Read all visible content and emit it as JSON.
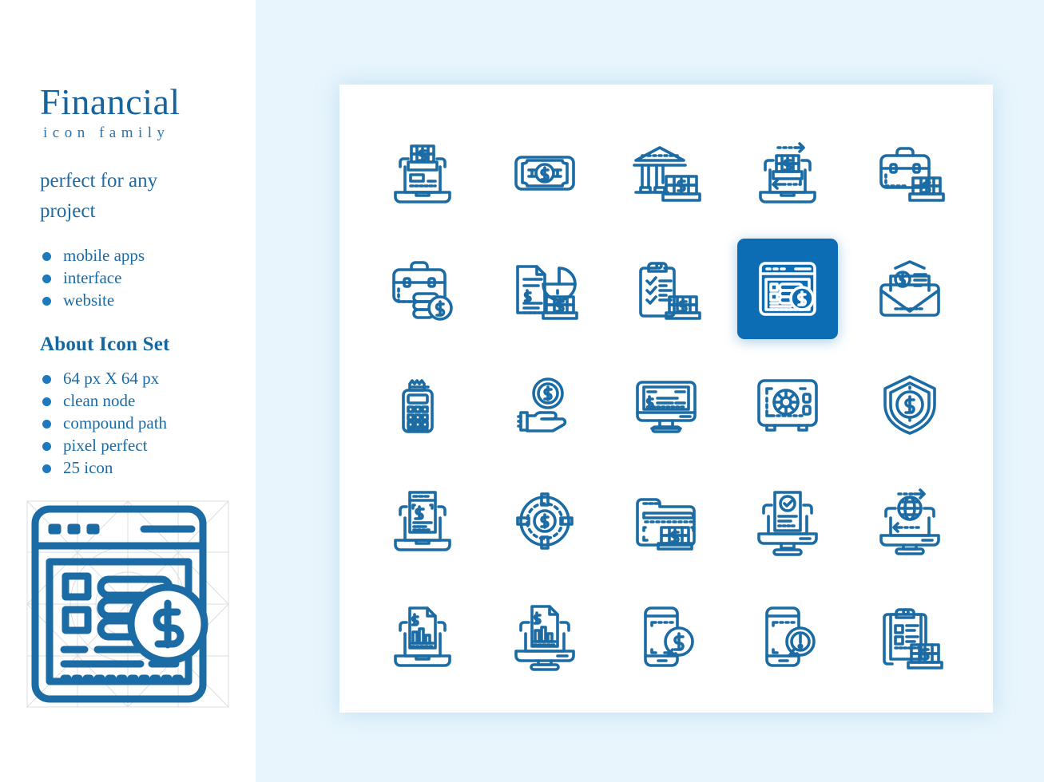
{
  "panel": {
    "title": "Financial",
    "subtitle": "icon family",
    "tagline": "perfect for any project",
    "usage_bullets": [
      "mobile apps",
      "interface",
      "website"
    ],
    "section_head": "About Icon Set",
    "spec_bullets": [
      "64 px X 64 px",
      "clean node",
      "compound path",
      "pixel perfect",
      "25 icon"
    ],
    "feature_icon": "invoice-webpage-dollar-icon"
  },
  "colors": {
    "brand_blue": "#1464a0",
    "icon_stroke": "#1b6ba5",
    "highlight_tile": "#0c6cb4",
    "right_background": "#e8f5fc",
    "card_background": "#ffffff",
    "bullet_dot": "#1f79bb"
  },
  "grid": {
    "columns": 5,
    "rows": 5,
    "highlight_index": 8,
    "icons": [
      {
        "index": 0,
        "name": "laptop-money-stack-icon",
        "label": "laptop with money stack"
      },
      {
        "index": 1,
        "name": "banknote-dollar-icon",
        "label": "banknote with dollar coin"
      },
      {
        "index": 2,
        "name": "bank-building-money-icon",
        "label": "bank building with money"
      },
      {
        "index": 3,
        "name": "laptop-money-transfer-icon",
        "label": "laptop money transfer"
      },
      {
        "index": 4,
        "name": "briefcase-money-stack-icon",
        "label": "briefcase with money stack"
      },
      {
        "index": 5,
        "name": "briefcase-coin-icon",
        "label": "briefcase with dollar coin"
      },
      {
        "index": 6,
        "name": "report-pie-chart-money-icon",
        "label": "financial report with pie chart"
      },
      {
        "index": 7,
        "name": "clipboard-checklist-money-icon",
        "label": "clipboard checklist with money"
      },
      {
        "index": 8,
        "name": "invoice-webpage-dollar-icon",
        "label": "online invoice web page"
      },
      {
        "index": 9,
        "name": "envelope-money-letter-icon",
        "label": "envelope with money letter"
      },
      {
        "index": 10,
        "name": "pos-terminal-receipt-icon",
        "label": "POS terminal with receipt"
      },
      {
        "index": 11,
        "name": "hand-holding-coin-icon",
        "label": "hand holding dollar coin"
      },
      {
        "index": 12,
        "name": "monitor-invoice-icon",
        "label": "monitor with invoice"
      },
      {
        "index": 13,
        "name": "safe-vault-icon",
        "label": "safe vault"
      },
      {
        "index": 14,
        "name": "shield-dollar-icon",
        "label": "shield with dollar"
      },
      {
        "index": 15,
        "name": "laptop-invoice-icon",
        "label": "laptop with invoice"
      },
      {
        "index": 16,
        "name": "target-dollar-icon",
        "label": "target with dollar"
      },
      {
        "index": 17,
        "name": "folder-money-icon",
        "label": "folder with money stack"
      },
      {
        "index": 18,
        "name": "monitor-approved-document-icon",
        "label": "monitor with approved document"
      },
      {
        "index": 19,
        "name": "monitor-global-transfer-icon",
        "label": "monitor global money transfer"
      },
      {
        "index": 20,
        "name": "laptop-bar-chart-report-icon",
        "label": "laptop with bar chart report"
      },
      {
        "index": 21,
        "name": "monitor-bar-chart-report-icon",
        "label": "monitor with bar chart report"
      },
      {
        "index": 22,
        "name": "phone-dollar-message-icon",
        "label": "phone with dollar message"
      },
      {
        "index": 23,
        "name": "phone-alert-message-icon",
        "label": "phone with alert message"
      },
      {
        "index": 24,
        "name": "clipboard-money-icon",
        "label": "clipboard with money stack"
      }
    ]
  }
}
